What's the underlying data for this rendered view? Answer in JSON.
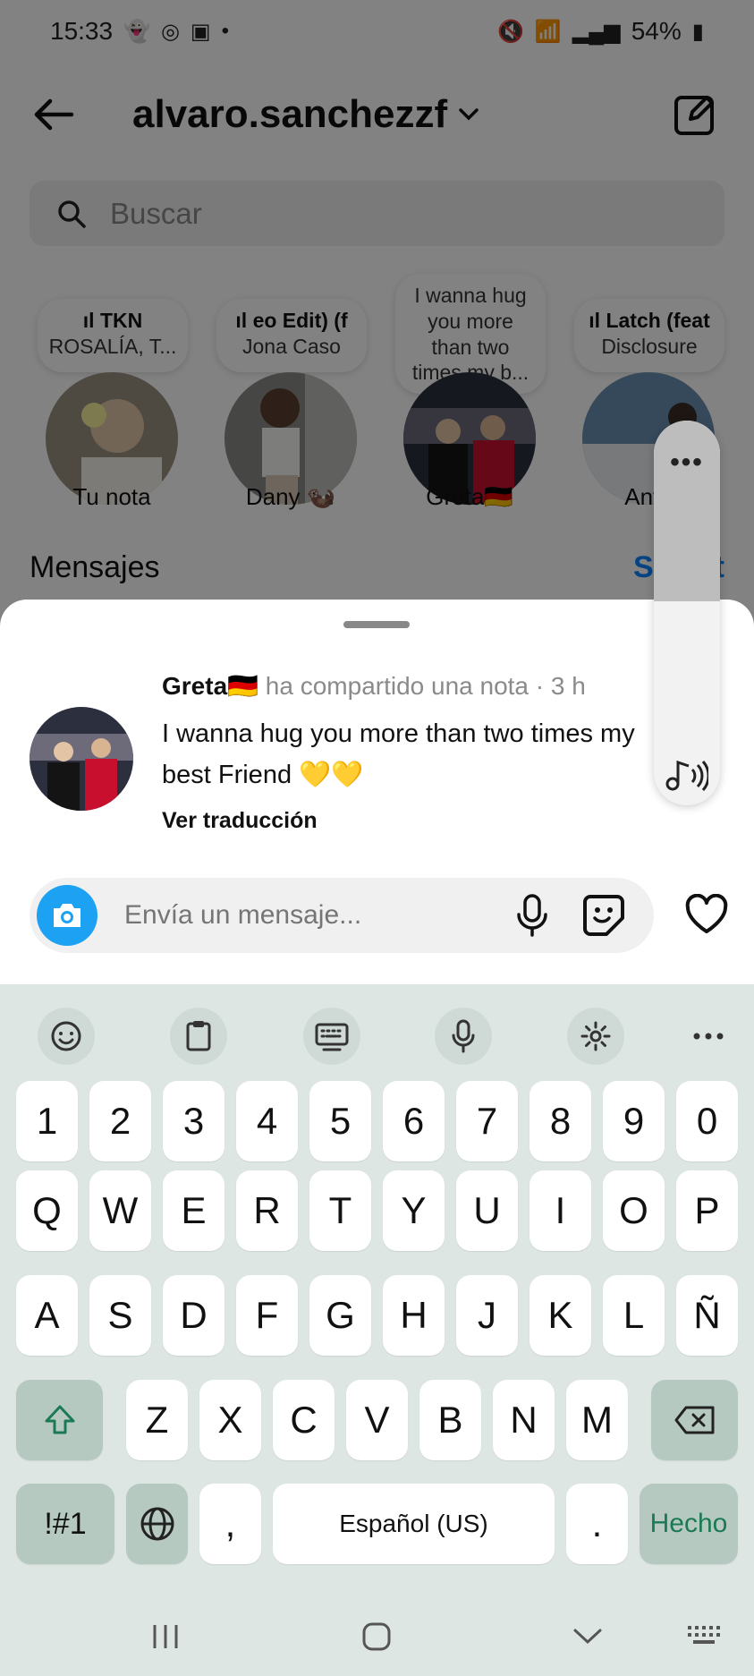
{
  "status_bar": {
    "time": "15:33",
    "battery": "54%",
    "left_icons": [
      "snapchat-icon",
      "instagram-icon",
      "gallery-icon",
      "dot-icon"
    ],
    "right_icons": [
      "mute-icon",
      "wifi-icon",
      "signal-icon",
      "battery-icon"
    ]
  },
  "header": {
    "username": "alvaro.sanchezzf",
    "chevron": "⌄"
  },
  "search": {
    "placeholder": "Buscar"
  },
  "notes": [
    {
      "title": "TKN",
      "subtitle": "ROSALÍA, T...",
      "name": "Tu nota"
    },
    {
      "title": "eo Edit) (f",
      "subtitle": "Jona Caso",
      "name": "Dany 🦦"
    },
    {
      "text": "I wanna hug you more than two times my b...",
      "name": "Greta🇩🇪"
    },
    {
      "title": "Latch (feat",
      "subtitle": "Disclosure",
      "name": "Anto"
    }
  ],
  "section": {
    "title": "Mensajes",
    "requests": "Solicit"
  },
  "sheet": {
    "author": "Greta🇩🇪",
    "meta": "ha compartido una nota · 3 h",
    "note": "I wanna hug you more than two times my best Friend 💛💛",
    "translate": "Ver traducción",
    "composer_placeholder": "Envía un mensaje..."
  },
  "pill": {
    "dots": "•••"
  },
  "keyboard": {
    "row_numbers": [
      "1",
      "2",
      "3",
      "4",
      "5",
      "6",
      "7",
      "8",
      "9",
      "0"
    ],
    "row1": [
      "Q",
      "W",
      "E",
      "R",
      "T",
      "Y",
      "U",
      "I",
      "O",
      "P"
    ],
    "row2": [
      "A",
      "S",
      "D",
      "F",
      "G",
      "H",
      "J",
      "K",
      "L",
      "Ñ"
    ],
    "row3": [
      "Z",
      "X",
      "C",
      "V",
      "B",
      "N",
      "M"
    ],
    "symbols": "!#1",
    "comma": ",",
    "space": "Español (US)",
    "period": ".",
    "done": "Hecho"
  },
  "colors": {
    "accent": "#0a84ff",
    "camera": "#1da1f2",
    "keyboard_bg": "#dde6e3",
    "done_text": "#1b7a55"
  }
}
